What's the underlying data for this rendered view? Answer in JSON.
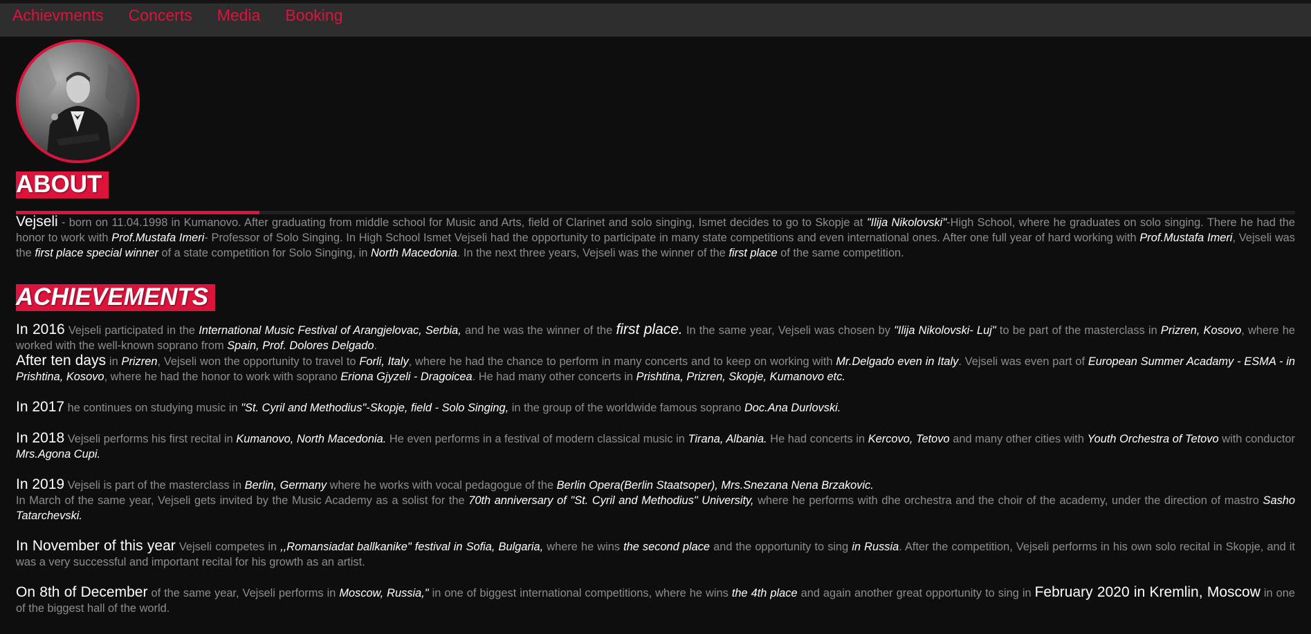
{
  "nav": {
    "items": [
      "Achievments",
      "Concerts",
      "Media",
      "Booking"
    ]
  },
  "about": {
    "title": "ABOUT",
    "p1": {
      "lead": "Vejseli",
      "t1": " - born on 11.04.1998 in Kumanovo. After graduating from middle school for Music and Arts, field of Clarinet and solo singing, Ismet decides to go to Skopje at ",
      "h1": "\"Ilija Nikolovski\"",
      "t2": "-High School, where he graduates on solo singing. There he had the honor to work with ",
      "h2": "Prof.Mustafa Imeri",
      "t3": "- Professor of Solo Singing. In High School Ismet Vejseli had the opportunity to participate in many state competitions and even international ones. After one full year of hard working with ",
      "h3": "Prof.Mustafa Imeri",
      "t4": ", Vejseli was the ",
      "h4": "first place special winner",
      "t5": " of a state competition for Solo Singing, in ",
      "h5": "North Macedonia",
      "t6": ". In the next three years, Vejseli was the winner of the ",
      "h6": "first place",
      "t7": " of the same competition."
    }
  },
  "achievements": {
    "title": "ACHIEVEMENTS",
    "y2016": {
      "lead": "In 2016",
      "t1": " Vejseli participated in the ",
      "h1": "International Music Festival of Arangjelovac, Serbia,",
      "t2": " and he was the winner of the ",
      "big1": "first place.",
      "t3": " In the same year, Vejseli was chosen by ",
      "h2": "\"Ilija Nikolovski- Luj\"",
      "t4": " to be part of the masterclass in ",
      "h3": "Prizren, Kosovo",
      "t5": ", where he worked with the well-known soprano from ",
      "h4": "Spain, Prof. Dolores Delgado",
      "t6": "."
    },
    "tendays": {
      "lead": "After ten days",
      "t1": " in ",
      "h1": "Prizren",
      "t2": ", Vejseli won the opportunity to travel to ",
      "h2": "Forli, Italy",
      "t3": ", where he had the chance to perform in many concerts and to keep on working with ",
      "h3": "Mr.Delgado even in Italy",
      "t4": ". Vejseli was even part of ",
      "h4": "European Summer Acadamy - ESMA - in Prishtina, Kosovo",
      "t5": ", where he had the honor to work with soprano ",
      "h5": "Eriona Gjyzeli - Dragoicea",
      "t6": ". He had many other concerts in ",
      "h6": "Prishtina, Prizren, Skopje, Kumanovo etc."
    },
    "y2017": {
      "lead": "In 2017",
      "t1": " he continues on studying music in ",
      "h1": "\"St. Cyril and Methodius\"-Skopje, field - Solo Singing,",
      "t2": " in the group of the worldwide famous soprano ",
      "h2": "Doc.Ana Durlovski."
    },
    "y2018": {
      "lead": "In 2018",
      "t1": " Vejseli performs his first recital in ",
      "h1": "Kumanovo, North Macedonia.",
      "t2": " He even performs in a festival of modern classical music in ",
      "h2": "Tirana, Albania.",
      "t3": " He had concerts in ",
      "h3": "Kercovo, Tetovo",
      "t4": " and many other cities with ",
      "h4": "Youth Orchestra of Tetovo",
      "t5": " with conductor ",
      "h5": "Mrs.Agona Cupi."
    },
    "y2019": {
      "lead": "In 2019",
      "t1": " Vejseli is part of the masterclass in ",
      "h1": "Berlin, Germany",
      "t2": " where he works with vocal pedagogue of the ",
      "h2": "Berlin Opera(Berlin Staatsoper), Mrs.Snezana Nena Brzakovic.",
      "t3": "In March of the same year, Vejseli gets invited by the Music Academy as a solist for the ",
      "h3": "70th anniversary of \"St. Cyril and Methodius\" University,",
      "t4": " where he performs with dhe orchestra and the choir of the academy, under the direction of mastro ",
      "h4": "Sasho Tatarchevski."
    },
    "november": {
      "lead": "In November of this year",
      "t1": " Vejseli competes in ",
      "h1": ",,Romansiadat ballkanike\" festival in Sofia, Bulgaria,",
      "t2": " where he wins ",
      "h2": "the second place",
      "t3": " and the opportunity to sing ",
      "h3": "in Russia",
      "t4": ". After the competition, Vejseli performs in his own solo recital in Skopje, and it was a very successful and important recital for his growth as an artist."
    },
    "december": {
      "lead": "On 8th of December",
      "t1": " of the same year, Vejseli performs in ",
      "h1": "Moscow, Russia,\"",
      "t2": " in one of biggest international competitions, where he wins ",
      "h2": "the 4th place",
      "t3": " and again another great opportunity to sing in ",
      "big1": "February 2020 in Kremlin, Moscow",
      "t4": " in one of the biggest hall of the world."
    }
  },
  "colors": {
    "accent": "#dc143c",
    "background": "#0e0e0e",
    "navbar": "#2e2e2e",
    "body_text": "#8d8d8d",
    "highlight": "#ffffff"
  }
}
